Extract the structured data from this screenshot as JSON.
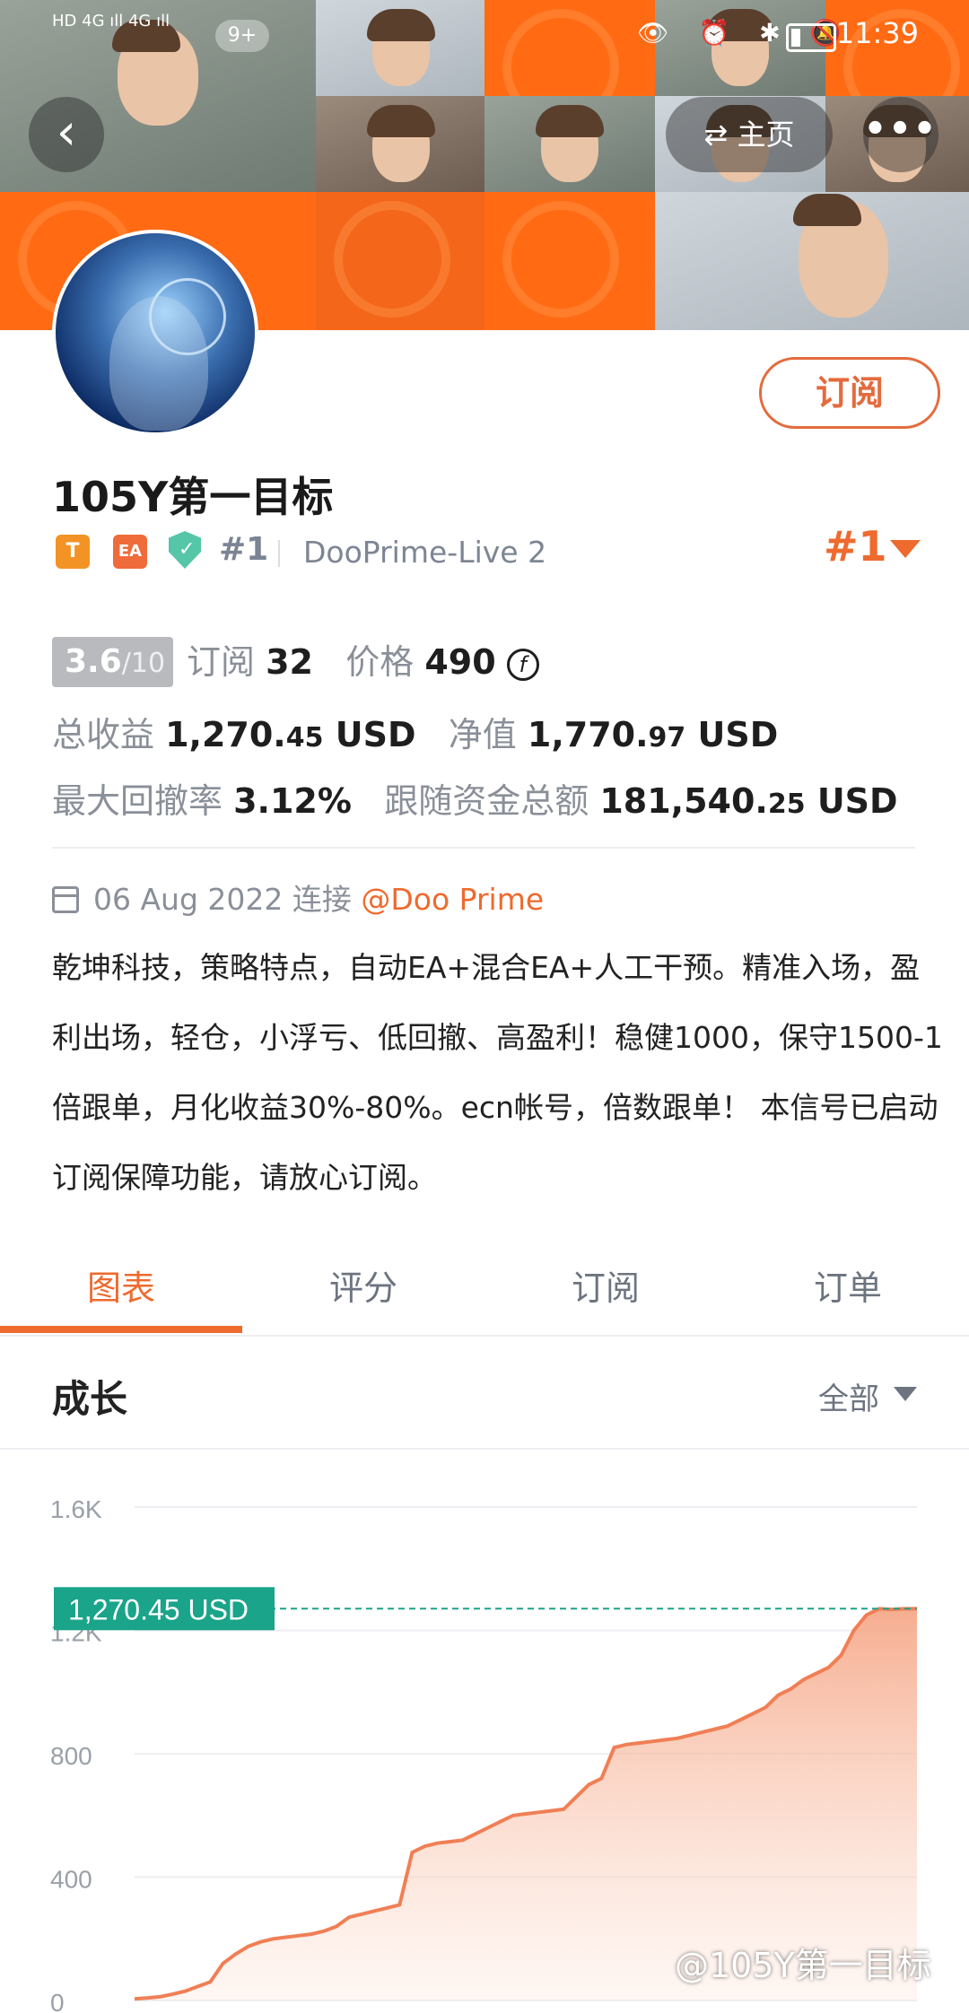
{
  "status_bar": {
    "left_text": "HD 4G ıll 4G ıll",
    "badge": "9+",
    "icons": "👁 ⏰ ✱ 🔕",
    "time": "11:39"
  },
  "nav": {
    "back_icon": "chevron-left-icon",
    "home_label": "主页",
    "home_icon": "swap-icon",
    "more_label": "•••"
  },
  "profile": {
    "subscribe_label": "订阅",
    "name": "105Y第一目标",
    "badge_t": "T",
    "badge_ea": "EA",
    "shield_check": "✓",
    "rank_small": "#1",
    "server": "DooPrime-Live 2",
    "rank_big": "#1"
  },
  "stats": {
    "score": "3.6",
    "score_denom": "/10",
    "subscribe_label": "订阅",
    "subscribe_count": "32",
    "price_label": "价格",
    "price_value": "490",
    "coin_symbol": "f",
    "total_profit_label": "总收益",
    "total_profit_int": "1,270.",
    "total_profit_dec": "45",
    "total_profit_unit": "USD",
    "equity_label": "净值",
    "equity_int": "1,770.",
    "equity_dec": "97",
    "equity_unit": "USD",
    "drawdown_label": "最大回撤率",
    "drawdown_value": "3.12%",
    "follow_label": "跟随资金总额",
    "follow_int": "181,540.",
    "follow_dec": "25",
    "follow_unit": "USD"
  },
  "info": {
    "date_text": "06 Aug 2022 连接",
    "broker": "@Doo Prime",
    "description": "乾坤科技，策略特点，自动EA+混合EA+人工干预。精准入场，盈利出场，轻仓，小浮亏、低回撤、高盈利！稳健1000，保守1500-1倍跟单，月化收益30%-80%。ecn帐号，倍数跟单！ 本信号已启动订阅保障功能，请放心订阅。"
  },
  "tabs": [
    {
      "label": "图表",
      "active": true
    },
    {
      "label": "评分",
      "active": false
    },
    {
      "label": "订阅",
      "active": false
    },
    {
      "label": "订单",
      "active": false
    }
  ],
  "growth": {
    "title": "成长",
    "filter": "全部"
  },
  "chart_data": {
    "type": "area",
    "current_label": "1,270.45 USD",
    "current_value": 1270.45,
    "y_ticks": [
      "1.6K",
      "1.2K",
      "800",
      "400",
      "0"
    ],
    "y_tick_values": [
      1600,
      1200,
      800,
      400,
      0
    ],
    "ylim": [
      0,
      1600
    ],
    "grid": true,
    "line_color": "#f07f55",
    "fill_color": "#f6a98a",
    "ref_line_color": "#1aa48a",
    "values": [
      5,
      8,
      12,
      20,
      30,
      45,
      60,
      120,
      150,
      175,
      190,
      200,
      205,
      210,
      215,
      225,
      240,
      270,
      280,
      290,
      300,
      310,
      480,
      500,
      510,
      515,
      520,
      540,
      560,
      580,
      600,
      605,
      610,
      615,
      620,
      660,
      700,
      720,
      820,
      830,
      835,
      840,
      845,
      850,
      860,
      870,
      880,
      890,
      910,
      930,
      950,
      990,
      1010,
      1040,
      1060,
      1080,
      1120,
      1200,
      1250,
      1270,
      1268,
      1270,
      1270.45
    ]
  },
  "watermark": "@105Y第一目标"
}
